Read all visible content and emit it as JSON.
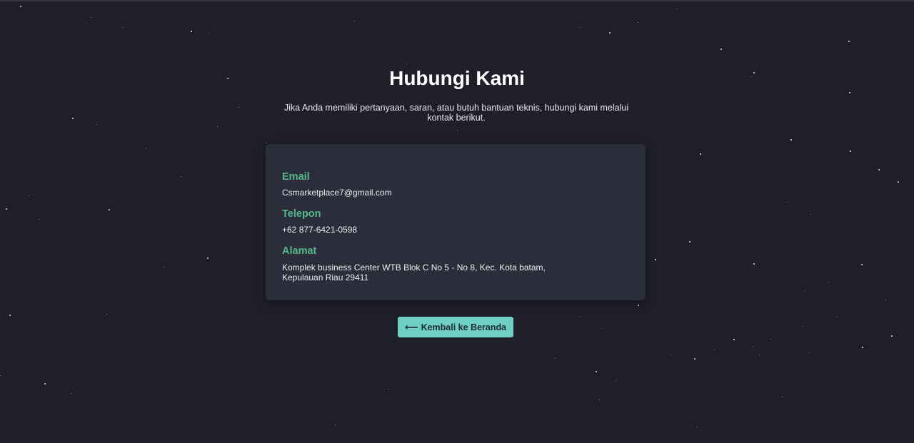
{
  "page": {
    "title": "Hubungi Kami",
    "subtitle": "Jika Anda memiliki pertanyaan, saran, atau butuh bantuan teknis, hubungi kami melalui kontak berikut."
  },
  "contact": {
    "email": {
      "label": "Email",
      "value": "Csmarketplace7@gmail.com"
    },
    "phone": {
      "label": "Telepon",
      "value": "+62 877-6421-0598"
    },
    "address": {
      "label": "Alamat",
      "value": "Komplek business Center WTB Blok C No 5 - No 8, Kec. Kota batam, Kepulauan Riau 29411"
    }
  },
  "back_button": {
    "icon": "arrow-left-icon",
    "label": "Kembali ke Beranda"
  },
  "colors": {
    "background": "#1e1f28",
    "card": "#2c2d3b",
    "label_accent": "#56b78a",
    "button": "#6ecfc3"
  }
}
